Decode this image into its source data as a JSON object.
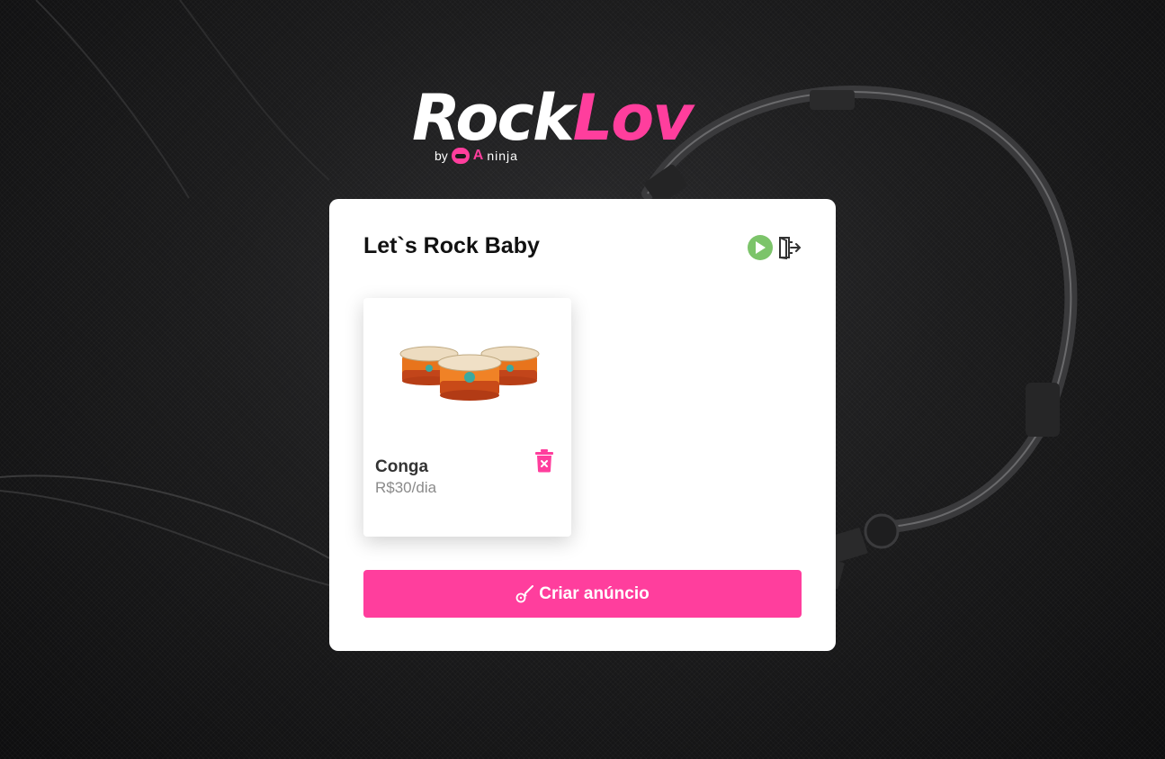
{
  "logo": {
    "part1": "Rock",
    "part2": "Lov",
    "by": "by",
    "qa": "A",
    "ninja": "ninja"
  },
  "card": {
    "title": "Let`s Rock Baby"
  },
  "items": [
    {
      "name": "Conga",
      "price": "R$30/dia"
    }
  ],
  "create_button": {
    "label": "Criar anúncio"
  },
  "colors": {
    "accent": "#ff3e9d",
    "play_green": "#7cc46a"
  },
  "icons": {
    "play": "play-icon",
    "logout": "logout-icon",
    "delete": "trash-icon",
    "create": "guitar-icon"
  }
}
